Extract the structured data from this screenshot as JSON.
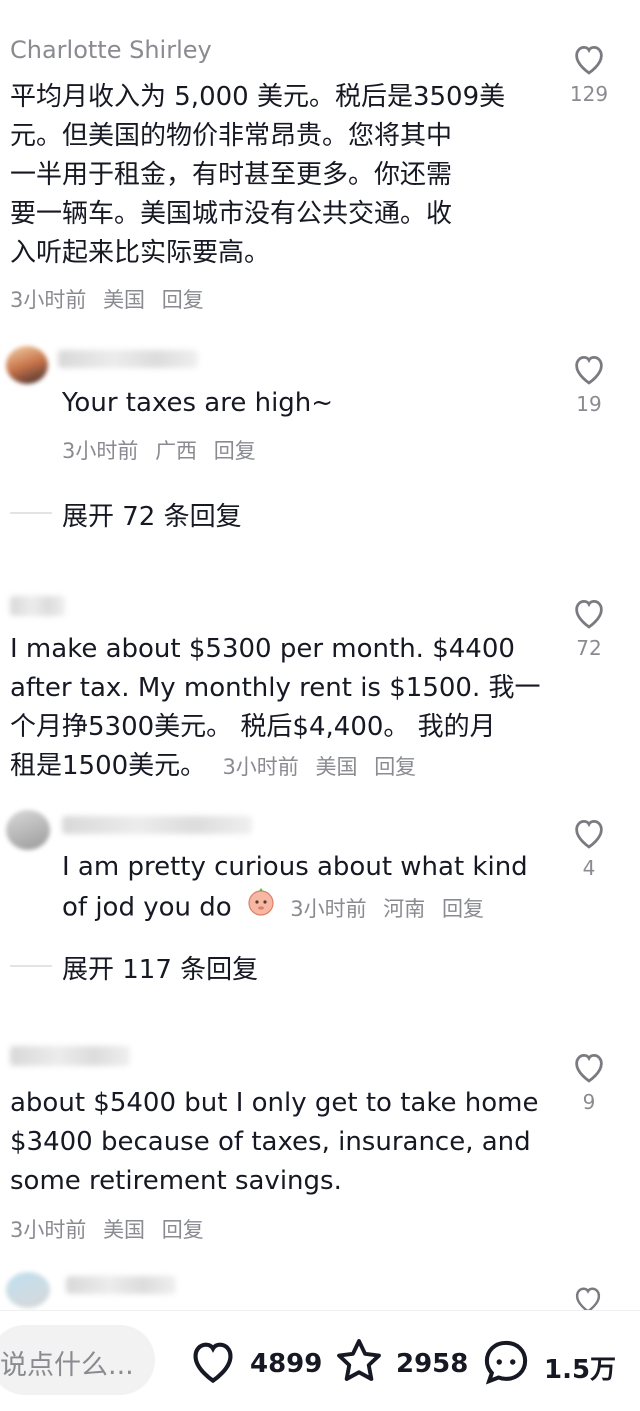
{
  "comments": [
    {
      "author": "Charlotte Shirley",
      "lines": [
        "平均月收入为 5,000 美元。税后是3509美",
        "元。但美国的物价非常昂贵。您将其中",
        "一半用于租金，有时甚至更多。你还需",
        "要一辆车。美国城市没有公共交通。收",
        "入听起来比实际要高。"
      ],
      "time": "3小时前",
      "location": "美国",
      "reply": "回复",
      "likes": "129"
    },
    {
      "text": "Your taxes are high~",
      "time": "3小时前",
      "location": "广西",
      "reply": "回复",
      "likes": "19"
    },
    {
      "expand": "展开 72 条回复"
    },
    {
      "lines": [
        "I make about $5300 per month. $4400",
        "after tax. My monthly rent is $1500. 我一",
        "个月挣5300美元。 税后$4,400。 我的月"
      ],
      "last_line": "租是1500美元。",
      "time": "3小时前",
      "location": "美国",
      "reply": "回复",
      "likes": "72"
    },
    {
      "line1": "I am pretty curious about what kind",
      "line2": "of jod you do",
      "time": "3小时前",
      "location": "河南",
      "reply": "回复",
      "likes": "4"
    },
    {
      "expand": "展开 117 条回复"
    },
    {
      "lines": [
        "about $5400 but I only get to take home",
        "$3400 because of taxes, insurance, and",
        "some retirement savings."
      ],
      "time": "3小时前",
      "location": "美国",
      "reply": "回复",
      "likes": "9"
    }
  ],
  "bottom": {
    "input_placeholder": "说点什么...",
    "likes": "4899",
    "favorites": "2958",
    "comments": "1.5万"
  },
  "icons": [
    "heart-outline-icon",
    "star-outline-icon",
    "comment-bubble-icon",
    "emoji-face-icon"
  ],
  "colors": {
    "text": "#161823",
    "secondary": "#8a8b91",
    "divider": "#e3e3e3"
  }
}
